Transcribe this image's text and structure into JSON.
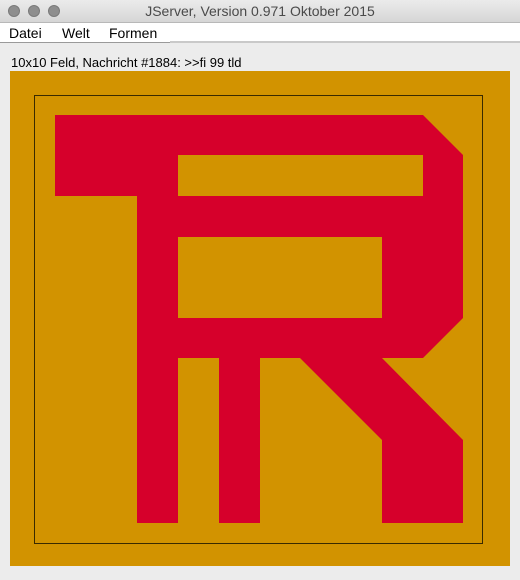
{
  "window": {
    "title": "JServer, Version 0.971 Oktober 2015"
  },
  "menu": {
    "items": [
      "Datei",
      "Welt",
      "Formen"
    ]
  },
  "status": {
    "text": "10x10 Feld, Nachricht #1884: >>fi 99 tld"
  },
  "board": {
    "background_color": "#d29300",
    "shape_color": "#d6002b",
    "frame_color": "#3a2a00"
  }
}
